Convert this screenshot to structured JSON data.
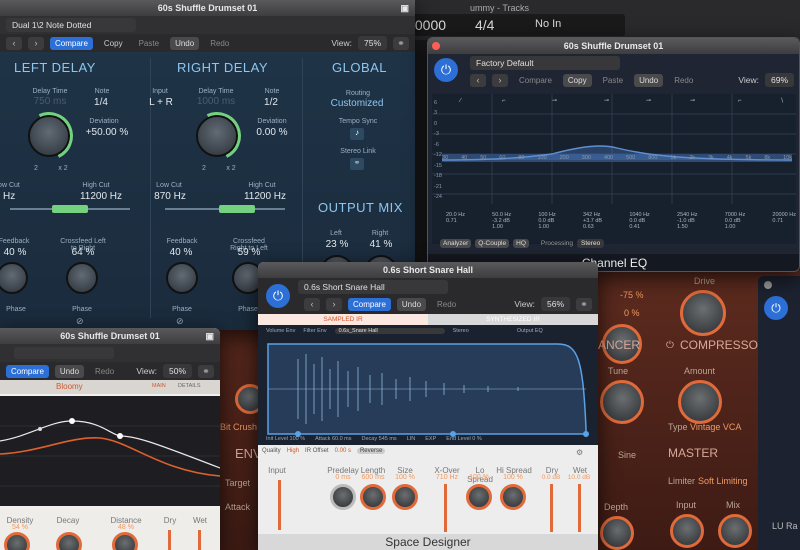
{
  "background_app": {
    "tracks_title": "ummy - Tracks",
    "counter": ".0000",
    "time_sig": "4/4",
    "no_in": "No In"
  },
  "delay_window": {
    "title": "60s Shuffle Drumset 01",
    "preset": "Dual 1\\2 Note Dotted",
    "compare": "Compare",
    "copy": "Copy",
    "paste": "Paste",
    "undo": "Undo",
    "redo": "Redo",
    "view_label": "View:",
    "view_value": "75%",
    "left_delay": "LEFT DELAY",
    "right_delay": "RIGHT DELAY",
    "global": "GLOBAL",
    "delay_time_label": "Delay Time",
    "delay_time_left": "750 ms",
    "delay_time_right": "1000 ms",
    "note_label": "Note",
    "note_left": "1/4",
    "note_right": "1/2",
    "input_label": "Input",
    "input_right": "L + R",
    "deviation_label": "Deviation",
    "deviation_left": "+50.00 %",
    "deviation_right": "0.00 %",
    "mult_2": "2",
    "mult_x2": "x 2",
    "low_cut_label": "Low Cut",
    "low_cut_left": "0 Hz",
    "low_cut_right": "870 Hz",
    "high_cut_label": "High Cut",
    "high_cut_left": "11200 Hz",
    "high_cut_right": "11200 Hz",
    "feedback_label": "Feedback",
    "feedback_left": "40 %",
    "feedback_right": "40 %",
    "crossfeed_lr_label": "Crossfeed Left to Right",
    "crossfeed_lr": "64 %",
    "crossfeed_rl_label": "Crossfeed Right to Left",
    "crossfeed_rl": "59 %",
    "phase_label": "Phase",
    "routing_label": "Routing",
    "routing_value": "Customized",
    "tempo_sync_label": "Tempo Sync",
    "stereo_link_label": "Stereo Link",
    "output_mix": "OUTPUT MIX",
    "left_label": "Left",
    "left_value": "23 %",
    "right_label": "Right",
    "right_value": "41 %"
  },
  "eq_window": {
    "title": "60s Shuffle Drumset 01",
    "preset": "Factory Default",
    "compare": "Compare",
    "copy": "Copy",
    "paste": "Paste",
    "undo": "Undo",
    "redo": "Redo",
    "view_label": "View:",
    "view_value": "69%",
    "freq_labels": [
      "30",
      "40",
      "50",
      "60",
      "80",
      "100",
      "200",
      "300",
      "400",
      "500",
      "800",
      "1k",
      "2k",
      "3k",
      "4k",
      "5k",
      "8k",
      "10k"
    ],
    "db_labels": [
      "6",
      "3",
      "0",
      "-3",
      "-6",
      "-12",
      "-15",
      "-18",
      "-21",
      "-24"
    ],
    "band_freqs": [
      "20.0 Hz",
      "50.0 Hz",
      "100 Hz",
      "342 Hz",
      "1040 Hz",
      "2540 Hz",
      "7000 Hz",
      "20000 Hz"
    ],
    "band_gains": [
      "",
      "-3.2 dB",
      "0.0 dB",
      "+3.7 dB",
      "0.0 dB",
      "-1.0 dB",
      "0.0 dB",
      ""
    ],
    "band_q": [
      "0.71",
      "1.00",
      "1.00",
      "0.63",
      "0.41",
      "1.50",
      "1.00",
      "0.71"
    ],
    "analyzer": "Analyzer",
    "qcouple": "Q-Couple",
    "hq": "HQ",
    "processing_label": "Processing",
    "processing_value": "Stereo",
    "plugin_name": "Channel EQ"
  },
  "bloomy_window": {
    "title": "60s Shuffle Drumset 01",
    "compare": "Compare",
    "undo": "Undo",
    "redo": "Redo",
    "view_label": "View:",
    "view_value": "50%",
    "preset_name": "Bloomy",
    "tab_main": "MAIN",
    "tab_details": "DETAILS",
    "knob_labels": [
      "Density",
      "Decay",
      "Distance",
      "Dry",
      "Wet"
    ],
    "knob_values": [
      "54 %",
      "",
      "48 %",
      "",
      ""
    ]
  },
  "space_designer": {
    "title": "0.6s Short Snare Hall",
    "preset": "0.6s Short Snare Hall",
    "compare": "Compare",
    "undo": "Undo",
    "redo": "Redo",
    "view_label": "View:",
    "view_value": "56%",
    "tab_sampled": "SAMPLED IR",
    "tab_synth": "SYNTHESIZED IR",
    "volume_env": "Volume Env",
    "filter_env": "Filter Env",
    "ir_name": "0.6s_Snare Hall",
    "stereo": "Stereo",
    "output_eq": "Output EQ",
    "init_level": "Init Level 100 %",
    "attack": "Attack 60.0 ms",
    "decay": "Decay 545 ms",
    "lin": "LIN",
    "exp": "EXP",
    "end_level": "End Level 0 %",
    "quality_label": "Quality",
    "quality_value": "High",
    "ir_offset_label": "IR Offset",
    "ir_offset_value": "0.00 s",
    "reverse": "Reverse",
    "input_label": "Input",
    "predelay_label": "Predelay",
    "predelay_value": "0 ms",
    "length_label": "Length",
    "length_value": "600 ms",
    "size_label": "Size",
    "size_value": "100 %",
    "xover_label": "X-Over",
    "xover_value": "710 Hz",
    "lo_spread_label": "Lo Spread",
    "lo_spread_value": "100 %",
    "hi_spread_label": "Hi Spread",
    "hi_spread_value": "100 %",
    "dry_label": "Dry",
    "dry_value": "0.0 dB",
    "wet_label": "Wet",
    "wet_value": "10.0 dB",
    "plugin_name": "Space Designer"
  },
  "orange_plugin": {
    "bit_crush": "Bit Crush",
    "env_header": "ENV",
    "target_label": "Target",
    "attack_label": "Attack",
    "depth_label": "Depth",
    "depth_value": "-75 %",
    "percent_0": "0 %",
    "drive_label": "Drive",
    "ancer": "ANCER",
    "compressor": "COMPRESSOR",
    "tune_label": "Tune",
    "amount_label": "Amount",
    "sine_label": "Sine",
    "type_label": "Type",
    "type_value": "Vintage VCA",
    "master": "MASTER",
    "limiter_label": "Limiter",
    "limiter_value": "Soft Limiting",
    "input_label": "Input",
    "mix_label": "Mix",
    "depth2_label": "Depth",
    "lu_label": "LU Ra"
  },
  "colors": {
    "delay_bg": "#1e3146",
    "delay_accent": "#74d17f",
    "eq_bg": "#1e2838",
    "orange_bg": "#5a2a1e",
    "accent_blue": "#2c6fd6"
  }
}
